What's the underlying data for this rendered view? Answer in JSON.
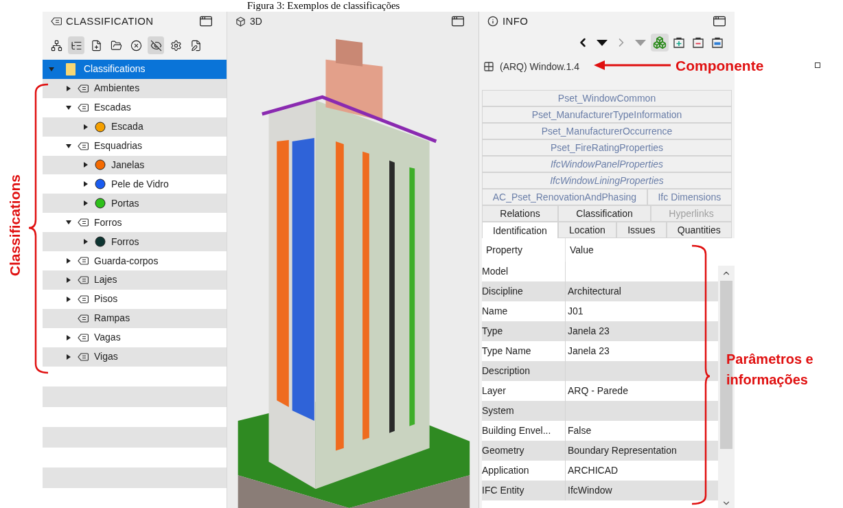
{
  "caption": "Figura 3: Exemplos de classificações",
  "classification_panel": {
    "title": "CLASSIFICATION",
    "toolbar": [
      {
        "kind": "hierarchy",
        "pressed": false
      },
      {
        "kind": "tree",
        "pressed": true
      },
      {
        "kind": "new-file",
        "pressed": false
      },
      {
        "kind": "open-folder",
        "pressed": false
      },
      {
        "kind": "clear",
        "pressed": false
      },
      {
        "kind": "hide",
        "pressed": true
      },
      {
        "kind": "settings",
        "pressed": false
      },
      {
        "kind": "edit",
        "pressed": false
      }
    ],
    "tree": [
      {
        "label": "Classifications",
        "kind": "root",
        "expandable": true,
        "expanded": true,
        "selected": true,
        "children": [
          {
            "label": "Ambientes",
            "kind": "group",
            "expandable": true,
            "expanded": false,
            "selected": false
          },
          {
            "label": "Escadas",
            "kind": "group",
            "expandable": true,
            "expanded": true,
            "selected": false,
            "children": [
              {
                "label": "Escada",
                "kind": "class",
                "color": "#f5a000",
                "expandable": true,
                "expanded": false,
                "selected": false
              }
            ]
          },
          {
            "label": "Esquadrias",
            "kind": "group",
            "expandable": true,
            "expanded": true,
            "selected": false,
            "children": [
              {
                "label": "Janelas",
                "kind": "class",
                "color": "#f56a00",
                "expandable": true,
                "expanded": false,
                "selected": false
              },
              {
                "label": "Pele de Vidro",
                "kind": "class",
                "color": "#1a5cf0",
                "expandable": true,
                "expanded": false,
                "selected": false
              },
              {
                "label": "Portas",
                "kind": "class",
                "color": "#2ec01a",
                "expandable": true,
                "expanded": false,
                "selected": false
              }
            ]
          },
          {
            "label": "Forros",
            "kind": "group",
            "expandable": true,
            "expanded": true,
            "selected": false,
            "children": [
              {
                "label": "Forros",
                "kind": "class",
                "color": "#0e3532",
                "expandable": true,
                "expanded": false,
                "selected": false
              }
            ]
          },
          {
            "label": "Guarda-corpos",
            "kind": "group",
            "expandable": true,
            "expanded": false,
            "selected": false
          },
          {
            "label": "Lajes",
            "kind": "group",
            "expandable": true,
            "expanded": false,
            "selected": false
          },
          {
            "label": "Pisos",
            "kind": "group",
            "expandable": true,
            "expanded": false,
            "selected": false
          },
          {
            "label": "Rampas",
            "kind": "group",
            "expandable": false,
            "selected": false
          },
          {
            "label": "Vagas",
            "kind": "group",
            "expandable": true,
            "expanded": false,
            "selected": false
          },
          {
            "label": "Vigas",
            "kind": "group",
            "expandable": true,
            "expanded": false,
            "selected": false
          }
        ]
      }
    ]
  },
  "viewport_panel": {
    "title": "3D"
  },
  "info_panel": {
    "title": "INFO",
    "toolbar": [
      {
        "kind": "back",
        "disabled": false,
        "pressed": false
      },
      {
        "kind": "menu",
        "disabled": false,
        "pressed": false
      },
      {
        "kind": "forward",
        "disabled": true,
        "pressed": false
      },
      {
        "kind": "menu",
        "disabled": true,
        "pressed": false
      },
      {
        "kind": "model",
        "disabled": false,
        "pressed": true
      },
      {
        "kind": "add",
        "disabled": false,
        "pressed": false
      },
      {
        "kind": "remove",
        "disabled": false,
        "pressed": false
      },
      {
        "kind": "equal",
        "disabled": false,
        "pressed": false
      }
    ],
    "component": "(ARQ) Window.1.4",
    "tab_rows": [
      {
        "tabs": [
          {
            "label": "Pset_WindowCommon",
            "kind": "pset",
            "italic": false,
            "disabled": false,
            "selected": false
          }
        ]
      },
      {
        "tabs": [
          {
            "label": "Pset_ManufacturerTypeInformation",
            "kind": "pset",
            "italic": false,
            "disabled": false,
            "selected": false
          }
        ]
      },
      {
        "tabs": [
          {
            "label": "Pset_ManufacturerOccurrence",
            "kind": "pset",
            "italic": false,
            "disabled": false,
            "selected": false
          }
        ]
      },
      {
        "tabs": [
          {
            "label": "Pset_FireRatingProperties",
            "kind": "pset",
            "italic": false,
            "disabled": false,
            "selected": false
          }
        ]
      },
      {
        "tabs": [
          {
            "label": "IfcWindowPanelProperties",
            "kind": "pset",
            "italic": true,
            "disabled": false,
            "selected": false
          }
        ]
      },
      {
        "tabs": [
          {
            "label": "IfcWindowLiningProperties",
            "kind": "pset",
            "italic": true,
            "disabled": false,
            "selected": false
          }
        ]
      },
      {
        "tabs": [
          {
            "label": "AC_Pset_RenovationAndPhasing",
            "kind": "pset",
            "italic": false,
            "disabled": false,
            "selected": false
          },
          {
            "label": "Ifc Dimensions",
            "kind": "pset",
            "italic": false,
            "disabled": false,
            "selected": false
          }
        ]
      },
      {
        "tabs": [
          {
            "label": "Relations",
            "kind": "tab",
            "italic": false,
            "disabled": false,
            "selected": false
          },
          {
            "label": "Classification",
            "kind": "tab",
            "italic": false,
            "disabled": false,
            "selected": false
          },
          {
            "label": "Hyperlinks",
            "kind": "tab",
            "italic": false,
            "disabled": true,
            "selected": false
          }
        ]
      },
      {
        "tabs": [
          {
            "label": "Identification",
            "kind": "tab",
            "italic": false,
            "disabled": false,
            "selected": true
          },
          {
            "label": "Location",
            "kind": "tab",
            "italic": false,
            "disabled": false,
            "selected": false
          },
          {
            "label": "Issues",
            "kind": "tab",
            "italic": false,
            "disabled": false,
            "selected": false
          },
          {
            "label": "Quantities",
            "kind": "tab",
            "italic": false,
            "disabled": false,
            "selected": false
          }
        ]
      }
    ],
    "table": {
      "columns": [
        "Property",
        "Value"
      ],
      "rows": [
        {
          "property": "Model"
        },
        {
          "property": "Discipline",
          "value": "Architectural"
        },
        {
          "property": "Name",
          "value": "J01"
        },
        {
          "property": "Type",
          "value": "Janela 23"
        },
        {
          "property": "Type Name",
          "value": "Janela 23"
        },
        {
          "property": "Description"
        },
        {
          "property": "Layer",
          "value": "ARQ - Parede"
        },
        {
          "property": "System"
        },
        {
          "property": "Building Envel...",
          "value": "False"
        },
        {
          "property": "Geometry",
          "value": "Boundary Representation"
        },
        {
          "property": "Application",
          "value": "ARCHICAD"
        },
        {
          "property": "IFC Entity",
          "value": "IfcWindow"
        }
      ]
    }
  },
  "annotations": {
    "classifications": "Classifications",
    "component": "Componente",
    "parameters": "Parâmetros e informações"
  }
}
